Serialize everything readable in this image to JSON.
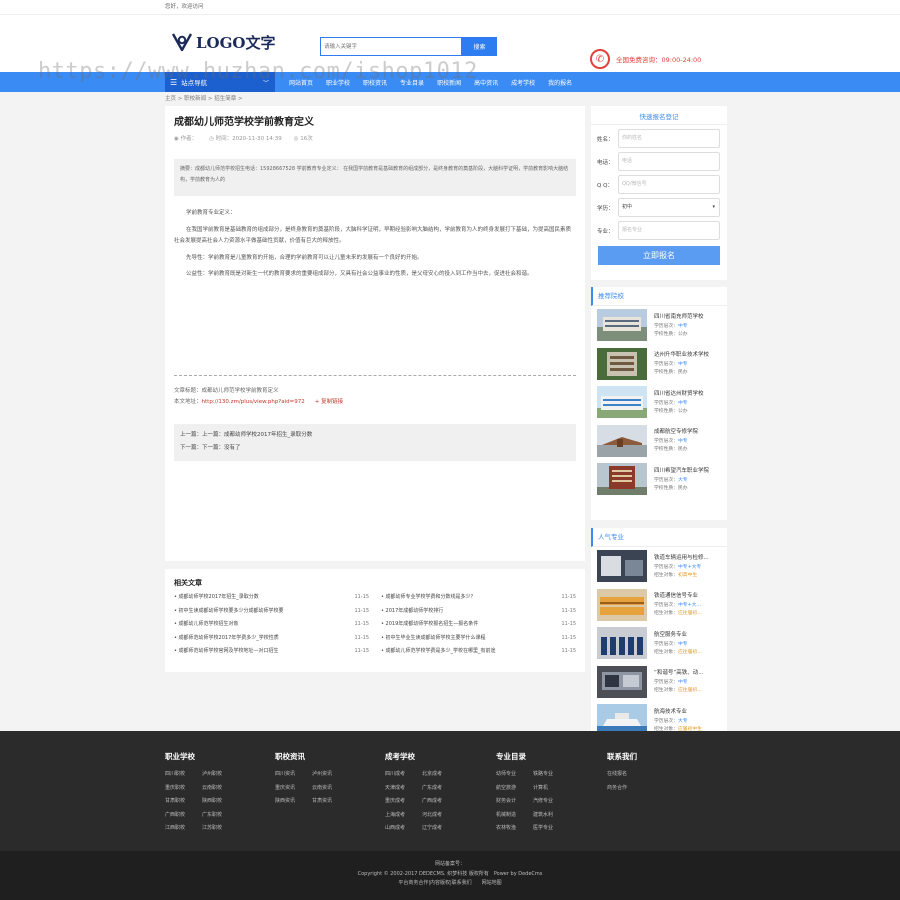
{
  "topbar": {
    "greeting": "您好，欢迎访问"
  },
  "header": {
    "logo_text": "LOGO文字",
    "search_placeholder": "请输入关键字",
    "search_button": "搜索",
    "hotline": "全国免费咨询：09:00-24:00",
    "watermark": "https://www.huzhan.com/ishop1012"
  },
  "nav": {
    "category_label": "站点导航",
    "items": [
      "网站首页",
      "职业学校",
      "职校资讯",
      "专业目录",
      "职校新闻",
      "高中资讯",
      "成考学校",
      "我的报名"
    ]
  },
  "breadcrumb": "主页 > 职校新闻 > 招生简章 >",
  "article": {
    "title": "成都幼儿师范学校学前教育定义",
    "author": "作者：",
    "time": "时间：2020-11-30 14:39",
    "views": "16次",
    "summary": "摘要：成都幼儿师范学校招生电话：15928667528 学前教育专业定义： 在我国学前教育是基础教育的组成部分，是终身教育的奠基阶段，大脑科学证明，学前教育影响大脑结构，学前教育为人的",
    "paragraphs": [
      "学前教育专业定义：",
      "在我国学前教育是基础教育的组成部分，是终身教育的奠基阶段，大脑科学证明，早期经验影响大脑结构，学前教育为人的终身发展打下基础，为提高国民素质社会发展提高社会人力资源水平做基础性贡献，价值有巨大的释放性。",
      "先导性：学前教育是儿童教育的开始，合理的学前教育可以让儿童未来的发展有一个良好的开始。",
      "公益性：学前教育既是对新生一代的教育要求的重要组成部分，又具有社会公益事业的性质，是父母安心的投入到工作当中去，促进社会和谐。"
    ],
    "source_title": "文章标题：成都幼儿师范学校学前教育定义",
    "source_url_label": "本文地址：",
    "source_url": "http://130.zm/plus/view.php?aid=972",
    "copy_link": "+ 复制链接",
    "prev": "上一篇：上一篇：成都幼师学校2017年招生_录取分数",
    "next": "下一篇：下一篇：没有了"
  },
  "related": {
    "title": "相关文章",
    "left": [
      {
        "t": "成都幼师学校2017年招生_录取分数",
        "d": "11-15"
      },
      {
        "t": "初中生读成都幼师学校要多少分成都幼师学校要",
        "d": "11-15"
      },
      {
        "t": "成都幼儿师范学校招生对象",
        "d": "11-15"
      },
      {
        "t": "成都师范幼师学校2017年学费多少_学校性质",
        "d": "11-15"
      },
      {
        "t": "成都师范幼师学校官网及学校地址—对口招生",
        "d": "11-15"
      }
    ],
    "right": [
      {
        "t": "成都幼师专业学校学费和分数线是多少？",
        "d": "11-15"
      },
      {
        "t": "2017年成都幼师学校排行",
        "d": "11-15"
      },
      {
        "t": "2019年成都幼师学校报名招生—报名条件",
        "d": "11-15"
      },
      {
        "t": "初中生毕业生读成都幼师学校主要学什么课程",
        "d": "11-15"
      },
      {
        "t": "成都幼儿师范学校学费是多少_学校在哪里_有前途",
        "d": "11-15"
      }
    ]
  },
  "signup": {
    "title": "快速报名登记",
    "fields": [
      {
        "label": "姓名：",
        "placeholder": "你的姓名"
      },
      {
        "label": "电话：",
        "placeholder": "电话"
      },
      {
        "label": "Q Q：",
        "placeholder": "QQ/微信号"
      },
      {
        "label": "学历：",
        "placeholder": "初中"
      },
      {
        "label": "专业：",
        "placeholder": "报名专业"
      }
    ],
    "submit": "立即报名"
  },
  "schools": {
    "title": "推荐院校",
    "items": [
      {
        "name": "四川省南充师范学校",
        "l1": "学历层次：",
        "v1": "中专",
        "l2": "学校性质：",
        "v2": "公办"
      },
      {
        "name": "达州升华职业技术学校",
        "l1": "学历层次：",
        "v1": "中专",
        "l2": "学校性质：",
        "v2": "民办"
      },
      {
        "name": "四川省达州财贸学校",
        "l1": "学历层次：",
        "v1": "中专",
        "l2": "学校性质：",
        "v2": "公办"
      },
      {
        "name": "成都航空专修学院",
        "l1": "学历层次：",
        "v1": "中专",
        "l2": "学校性质：",
        "v2": "民办"
      },
      {
        "name": "四川希望汽车职业学院",
        "l1": "学历层次：",
        "v1": "大专",
        "l2": "学校性质：",
        "v2": "民办"
      }
    ]
  },
  "majors": {
    "title": "人气专业",
    "items": [
      {
        "name": "铁道车辆运用与检修...",
        "l1": "学历层次：",
        "v1": "中专+大专",
        "l2": "招生对象：",
        "v2": "初高中生"
      },
      {
        "name": "铁道通信信号专业",
        "l1": "学历层次：",
        "v1": "中专+大...",
        "l2": "招生对象：",
        "v2": "应往届初..."
      },
      {
        "name": "航空服务专业",
        "l1": "学历层次：",
        "v1": "中专",
        "l2": "招生对象：",
        "v2": "应往届初..."
      },
      {
        "name": "“和谐号”高铁、动...",
        "l1": "学历层次：",
        "v1": "中专",
        "l2": "招生对象：",
        "v2": "应往届初..."
      },
      {
        "name": "航海技术专业",
        "l1": "学历层次：",
        "v1": "大专",
        "l2": "招生对象：",
        "v2": "应届初中生"
      }
    ]
  },
  "footer": {
    "columns": [
      {
        "title": "职业学校",
        "links": [
          "四川职校",
          "泸州职校",
          "重庆职校",
          "云南职校",
          "甘肃职校",
          "陕西职校",
          "广西职校",
          "广东职校",
          "江西职校",
          "江苏职校"
        ]
      },
      {
        "title": "职校资讯",
        "links": [
          "四川资讯",
          "泸州资讯",
          "重庆资讯",
          "云南资讯",
          "陕西资讯",
          "甘肃资讯"
        ]
      },
      {
        "title": "成考学校",
        "links": [
          "四川成考",
          "北京成考",
          "天津成考",
          "广东成考",
          "重庆成考",
          "广西成考",
          "上海成考",
          "河北成考",
          "山西成考",
          "辽宁成考"
        ]
      },
      {
        "title": "专业目录",
        "links": [
          "幼师专业",
          "铁路专业",
          "航空旅游",
          "计算机",
          "财务会计",
          "汽修专业",
          "机械制造",
          "建筑水利",
          "农林牧渔",
          "医学专业"
        ]
      },
      {
        "title": "联系我们",
        "links": [
          "在线报名",
          "商务合作"
        ]
      }
    ],
    "icp": "网站备案号：",
    "copyright": "Copyright © 2002-2017 DEDECMS. 织梦科技 版权所有　Power by DedeCms",
    "links_line": "平台商务合作|内容版权|联系我们　　网站地图"
  },
  "colors": {
    "accent": "#3b8bf5",
    "nav_dark": "#1c5fcf",
    "hotline": "#e3423c",
    "footer_bg": "#2b2b2b"
  }
}
